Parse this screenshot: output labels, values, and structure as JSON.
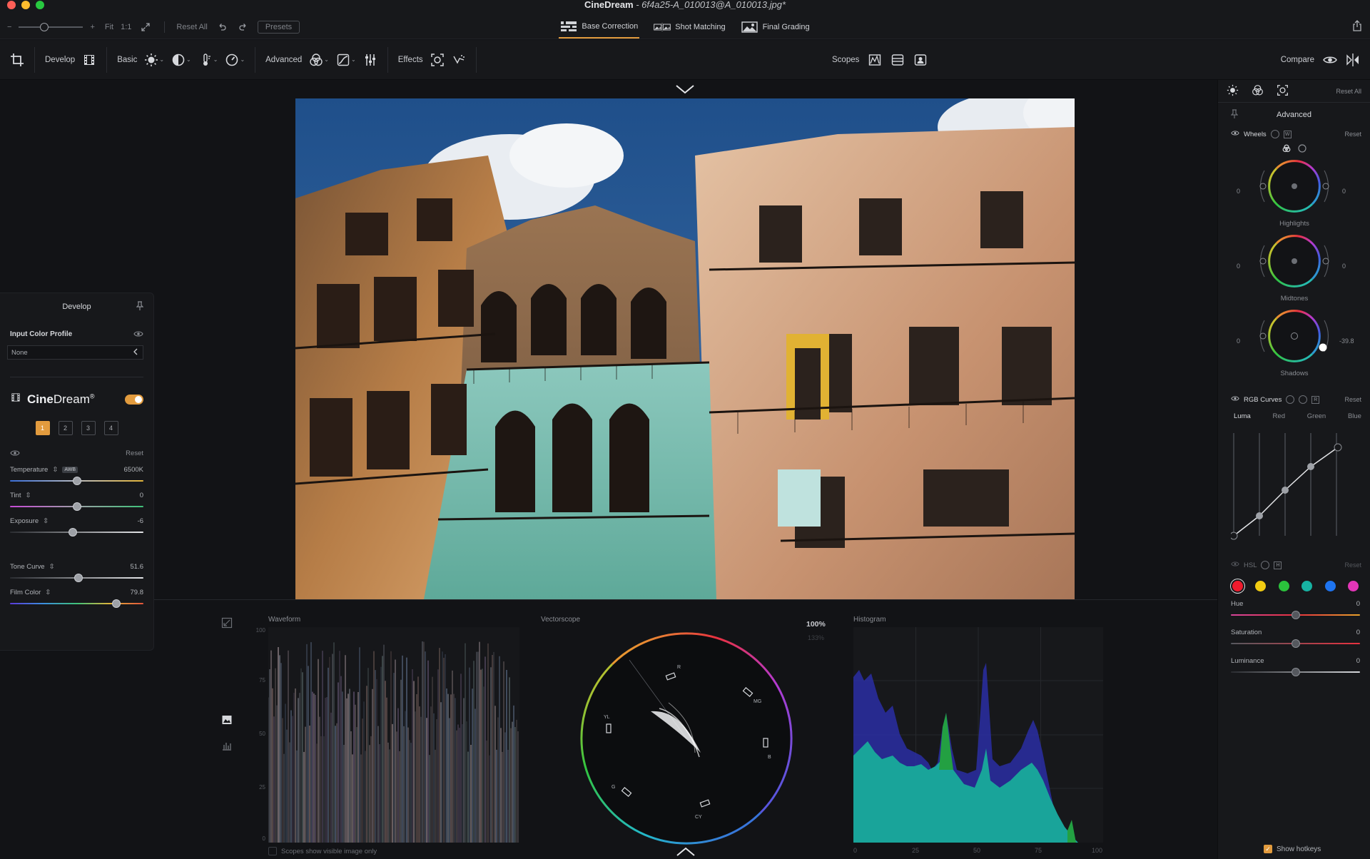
{
  "window": {
    "app_name": "CineDream",
    "file_name": " - 6f4a25-A_010013@A_010013.jpg*"
  },
  "titlebar": {
    "zoom_minus": "−",
    "zoom_plus": "+",
    "fit_label": "Fit",
    "one_to_one_label": "1:1",
    "reset_all_label": "Reset All",
    "presets_label": "Presets"
  },
  "mode_tabs": [
    {
      "label": "Base Correction",
      "active": true
    },
    {
      "label": "Shot Matching",
      "active": false
    },
    {
      "label": "Final Grading",
      "active": false
    }
  ],
  "toolbar": {
    "develop_label": "Develop",
    "basic_label": "Basic",
    "advanced_label": "Advanced",
    "effects_label": "Effects",
    "scopes_label": "Scopes",
    "compare_label": "Compare"
  },
  "develop_panel": {
    "title": "Develop",
    "input_profile_label": "Input Color Profile",
    "input_profile_value": "None",
    "brand_bold": "Cine",
    "brand_regular": "Dream",
    "brand_reg": "®",
    "preset_slots": [
      "1",
      "2",
      "3",
      "4"
    ],
    "reset_label": "Reset",
    "sliders": {
      "temperature": {
        "label": "Temperature",
        "badge": "AWB",
        "value": "6500K",
        "position": 0.5
      },
      "tint": {
        "label": "Tint",
        "value": "0",
        "position": 0.5
      },
      "exposure": {
        "label": "Exposure",
        "value": "-6",
        "position": 0.47
      },
      "tone_curve": {
        "label": "Tone Curve",
        "value": "51.6",
        "position": 0.516
      },
      "film_color": {
        "label": "Film Color",
        "value": "79.8",
        "position": 0.798
      }
    }
  },
  "scopes": {
    "waveform_title": "Waveform",
    "waveform_ticks": [
      "100",
      "75",
      "50",
      "25",
      "0"
    ],
    "vectorscope_title": "Vectorscope",
    "vectorscope_zoom": "100%",
    "vectorscope_zoom_secondary": "133%",
    "vectorscope_targets": {
      "r": "R",
      "mg": "MG",
      "b": "B",
      "cy": "CY",
      "g": "G",
      "yl": "YL"
    },
    "histogram_title": "Histogram",
    "histogram_ticks": [
      "0",
      "25",
      "50",
      "75",
      "100"
    ],
    "visible_only_label": "Scopes show visible image only"
  },
  "right_panel": {
    "reset_all_label": "Reset All",
    "title": "Advanced",
    "wheels_label": "Wheels",
    "wheels_badge": "W",
    "reset_label": "Reset",
    "wheels": [
      {
        "name": "Highlights",
        "left": "0",
        "right": "0"
      },
      {
        "name": "Midtones",
        "left": "0",
        "right": "0"
      },
      {
        "name": "Shadows",
        "left": "0",
        "right": "-39.8"
      }
    ],
    "rgb_curves_label": "RGB Curves",
    "rgb_curves_badge": "R",
    "curve_tabs": [
      "Luma",
      "Red",
      "Green",
      "Blue"
    ],
    "hsl_label": "HSL",
    "hsl_badge": "H",
    "hsl_colors": [
      "#ef1b2d",
      "#f2cc12",
      "#2bc23c",
      "#17b3a3",
      "#1e74f0",
      "#e436b8"
    ],
    "hsl_sliders": {
      "hue": {
        "label": "Hue",
        "value": "0",
        "position": 0.5
      },
      "saturation": {
        "label": "Saturation",
        "value": "0",
        "position": 0.5
      },
      "luminance": {
        "label": "Luminance",
        "value": "0",
        "position": 0.5
      }
    },
    "show_hotkeys_label": "Show hotkeys"
  },
  "colors": {
    "accent": "#e29b3e",
    "panel_bg": "#17181b",
    "canvas_bg": "#121316"
  }
}
